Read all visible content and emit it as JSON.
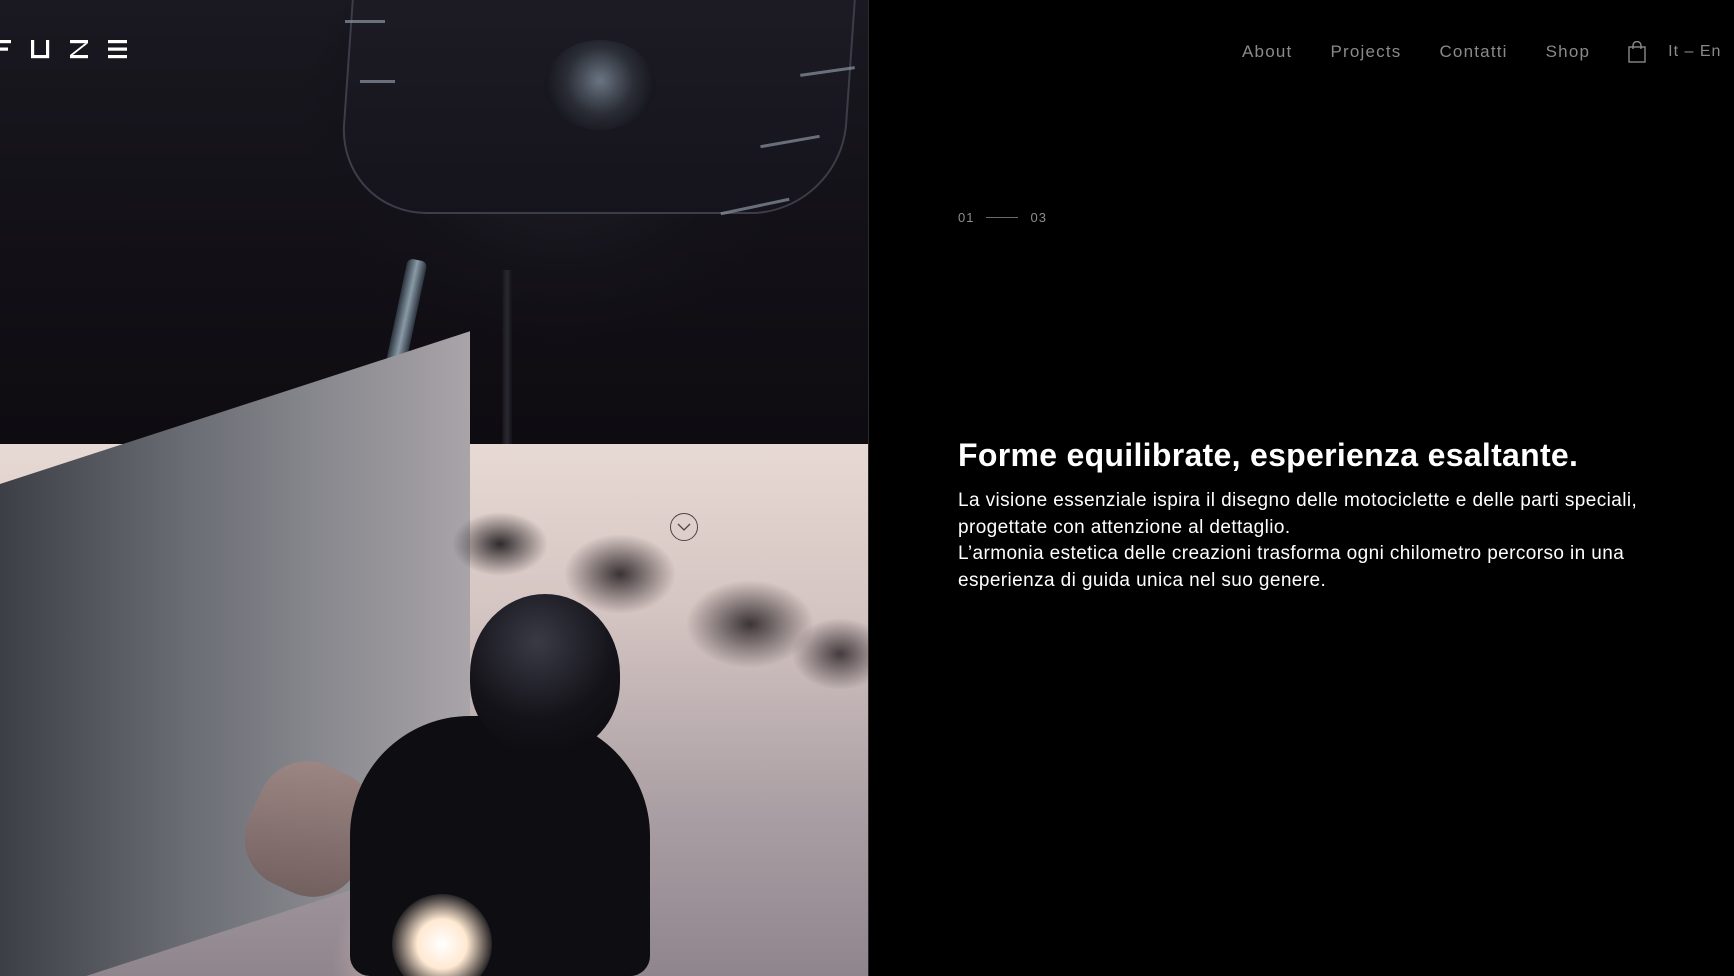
{
  "brand": {
    "logo_text": "FUZE",
    "accent_color": "#ffffff",
    "nav_text_color": "#8a8a8a",
    "background_color": "#000000"
  },
  "header": {
    "nav": [
      {
        "label": "About"
      },
      {
        "label": "Projects"
      },
      {
        "label": "Contatti"
      },
      {
        "label": "Shop"
      }
    ],
    "cart_icon": "shopping-bag-icon",
    "language": "It – En",
    "menu_icon": "hamburger-menu-icon"
  },
  "slider": {
    "current": "01",
    "total": "03"
  },
  "content": {
    "headline": "Forme equilibrate, esperienza esaltante.",
    "paragraph_1": "La visione essenziale ispira il disegno delle motociclette e delle parti speciali, progettate con attenzione al dettaglio.",
    "paragraph_2": "L’armonia estetica delle creazioni trasforma ogni chilometro percorso in una esperienza di guida unica nel suo genere."
  },
  "media": {
    "top_image": "motorcycle-headlight-closeup",
    "bottom_image": "rider-on-motorcycle-with-headlight",
    "scroll_icon": "chevron-down-circle-icon"
  }
}
